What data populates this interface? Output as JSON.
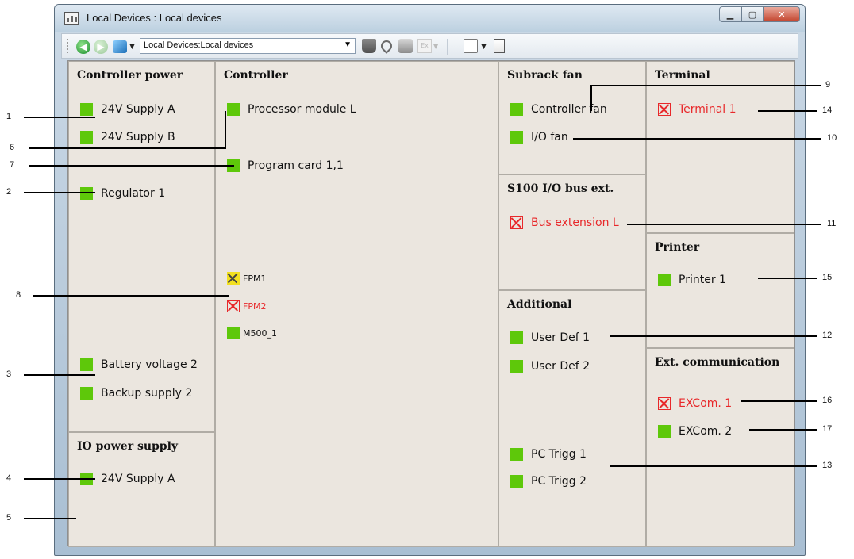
{
  "window": {
    "title": "Local Devices : Local devices",
    "min_glyph": "▁",
    "max_glyph": "▢",
    "close_glyph": "✕"
  },
  "toolbar": {
    "back_glyph": "◀",
    "forward_glyph": "▶",
    "address": "Local Devices:Local devices",
    "dropdown_glyph": "▼",
    "icons": [
      "back-arrow-icon",
      "forward-arrow-icon",
      "cube-icon",
      "download-icon",
      "pin-icon",
      "print-icon",
      "func-icon",
      "window-icon",
      "document-icon"
    ],
    "func_label": "Ex"
  },
  "panels": {
    "controller_power": {
      "title": "Controller power",
      "items": [
        "24V Supply A",
        "24V Supply B",
        "Regulator 1",
        "Battery voltage 2",
        "Backup supply 2"
      ]
    },
    "io_power": {
      "title": "IO power supply",
      "items": [
        "24V Supply A"
      ]
    },
    "controller": {
      "title": "Controller",
      "items": [
        "Processor module L",
        "Program card 1,1",
        "FPM1",
        "FPM2",
        "M500_1"
      ]
    },
    "subrack_fan": {
      "title": "Subrack fan",
      "items": [
        "Controller fan",
        "I/O fan"
      ]
    },
    "bus_ext": {
      "title": "S100 I/O bus ext.",
      "items": [
        "Bus extension L"
      ]
    },
    "additional": {
      "title": "Additional",
      "items": [
        "User Def 1",
        "User Def 2",
        "PC Trigg 1",
        "PC Trigg 2"
      ]
    },
    "terminal": {
      "title": "Terminal",
      "items": [
        "Terminal 1"
      ]
    },
    "printer": {
      "title": "Printer",
      "items": [
        "Printer 1"
      ]
    },
    "ext_comm": {
      "title": "Ext. communication",
      "items": [
        "EXCom. 1",
        "EXCom. 2"
      ]
    }
  },
  "status_colors": {
    "ok": "#5ec80a",
    "error": "#e8282a",
    "warning": "#f2e020"
  },
  "callouts": [
    "1",
    "2",
    "3",
    "4",
    "5",
    "6",
    "7",
    "8",
    "9",
    "10",
    "11",
    "12",
    "13",
    "14",
    "15",
    "16",
    "17"
  ]
}
